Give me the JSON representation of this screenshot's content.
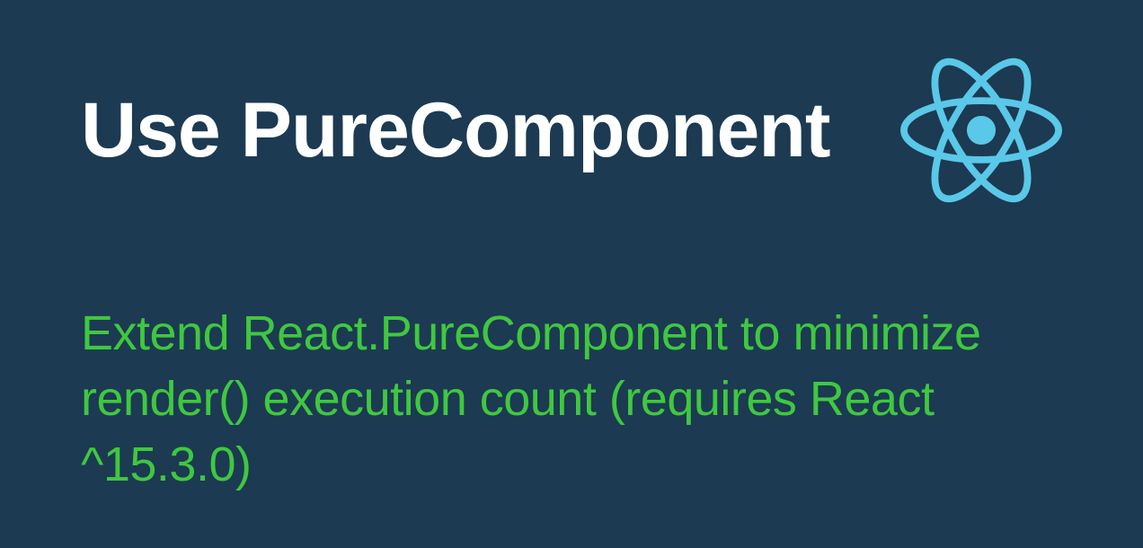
{
  "slide": {
    "title": "Use PureComponent",
    "description": "Extend React.PureComponent to minimize render() execution count (requires React ^15.3.0)",
    "logo": "react-logo-icon",
    "colors": {
      "background": "#1c3a52",
      "title": "#ffffff",
      "description": "#3fc83f",
      "logo": "#5ac8e8"
    }
  }
}
